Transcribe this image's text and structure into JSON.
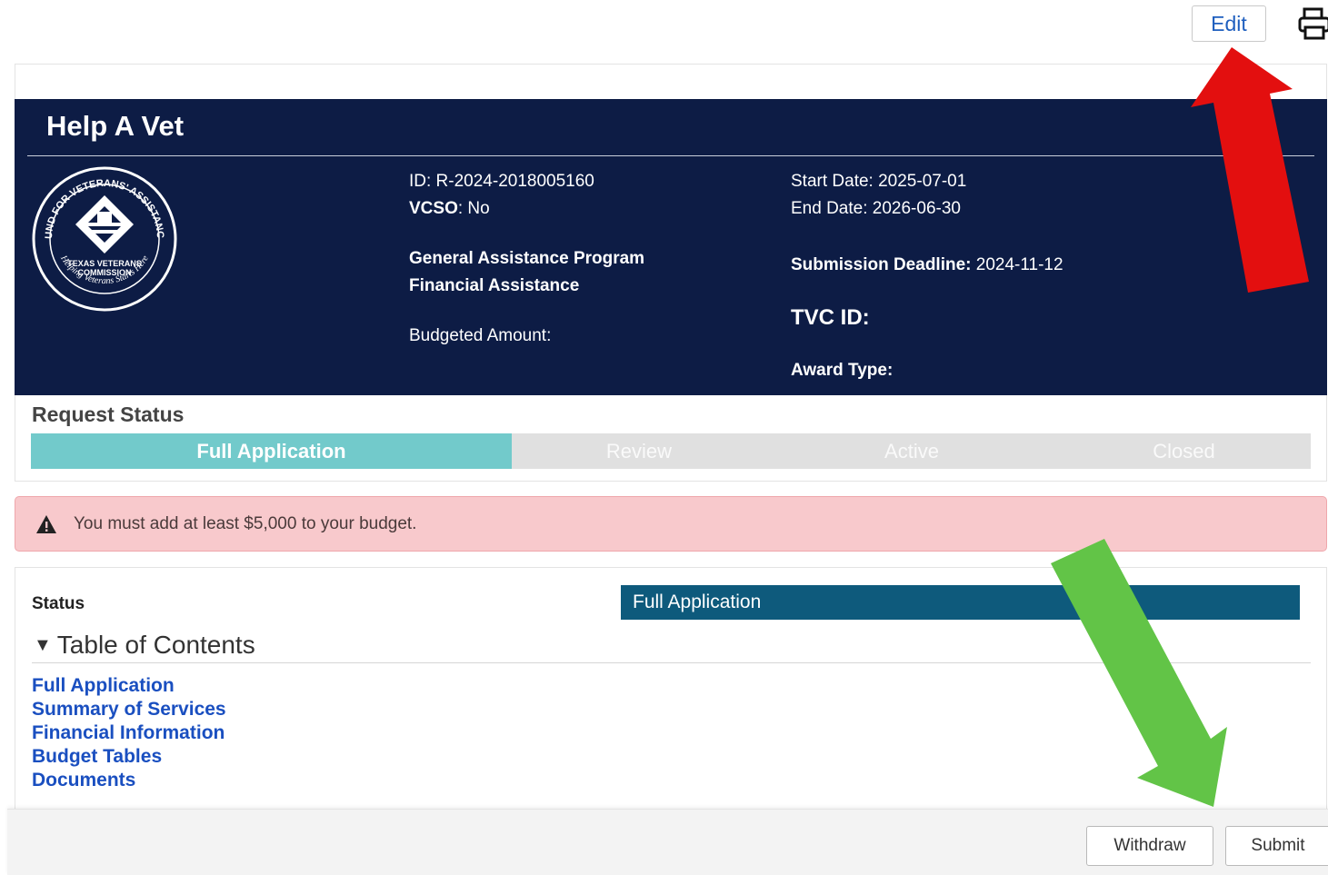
{
  "toolbar": {
    "edit_label": "Edit",
    "print_icon": "print-icon"
  },
  "banner": {
    "title": "Help A Vet",
    "seal_icon": "fund-for-veterans-assistance-seal",
    "seal_text_outer": "FUND FOR VETERANS' ASSISTANCE",
    "seal_text_center": "TEXAS VETERANS COMMISSION",
    "seal_text_bottom": "Helping Veterans Starts Here",
    "id_text": "ID: R-2024-2018005160",
    "vcso_label": "VCSO",
    "vcso_value": ": No",
    "program_line1": "General Assistance Program",
    "program_line2": "Financial Assistance",
    "budgeted_amount": "Budgeted Amount:",
    "start_date": "Start Date: 2025-07-01",
    "end_date": "End Date: 2026-06-30",
    "submission_label": "Submission Deadline:",
    "submission_value": " 2024-11-12",
    "tvc_id": "TVC ID:",
    "award_type": "Award Type:"
  },
  "request_status": {
    "title": "Request Status",
    "steps": [
      "Full Application",
      "Review",
      "Active",
      "Closed"
    ],
    "active_index": 0
  },
  "alert": {
    "icon": "warning-icon",
    "text": "You must add at least $5,000 to your budget."
  },
  "content": {
    "status_label": "Status",
    "status_value": "Full Application",
    "toc_title": "Table of Contents",
    "toc_items": [
      "Full Application",
      "Summary of Services",
      "Financial Information",
      "Budget Tables",
      "Documents"
    ]
  },
  "footer": {
    "withdraw_label": "Withdraw",
    "submit_label": "Submit"
  },
  "colors": {
    "banner": "#0d1c45",
    "active_step": "#72cacb",
    "status_bar": "#0e5a7c",
    "alert_bg": "#f8c9cc",
    "link": "#1a4fc0",
    "red_arrow": "#e30f0f",
    "green_arrow": "#62c447"
  }
}
